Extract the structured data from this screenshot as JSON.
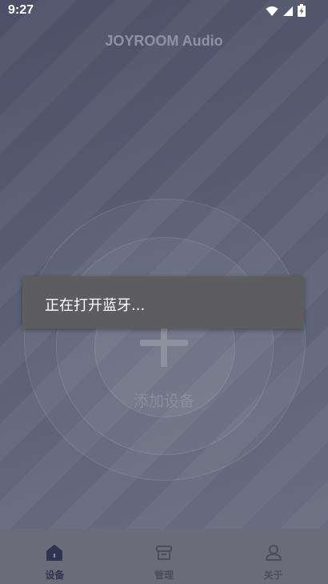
{
  "status_bar": {
    "time": "9:27",
    "icons": [
      "wifi-icon",
      "signal-icon",
      "battery-charging-icon"
    ]
  },
  "app": {
    "title": "JOYROOM Audio"
  },
  "main": {
    "add_device_label": "添加设备",
    "add_icon": "plus-icon"
  },
  "toast": {
    "message": "正在打开蓝牙..."
  },
  "bottom_nav": {
    "items": [
      {
        "label": "设备",
        "icon": "home-icon",
        "active": true
      },
      {
        "label": "管理",
        "icon": "box-icon",
        "active": false
      },
      {
        "label": "关于",
        "icon": "user-icon",
        "active": false
      }
    ]
  },
  "colors": {
    "background": "#555a6e",
    "title": "#8e93a3",
    "toast_bg": "#5d5d5f",
    "nav_bg": "#6a6d79",
    "nav_active": "#2f3550",
    "nav_inactive": "#4b4e59"
  }
}
